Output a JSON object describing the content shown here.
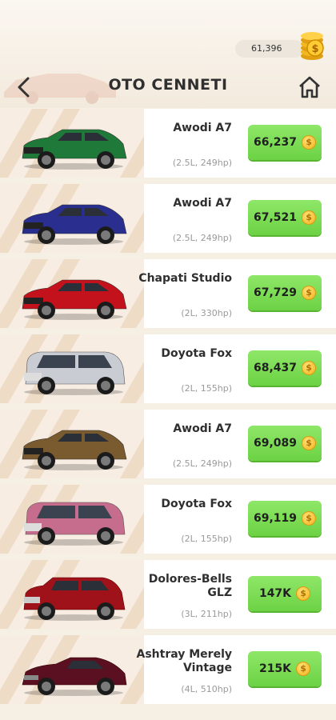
{
  "header": {
    "title": "OTO CENNETI",
    "coins": "61,396"
  },
  "cars": [
    {
      "name": "Awodi A7",
      "spec": "(2.5L, 249hp)",
      "price": "66,237",
      "color": "#1f7a3a",
      "shape": "sedan"
    },
    {
      "name": "Awodi A7",
      "spec": "(2.5L, 249hp)",
      "price": "67,521",
      "color": "#2a2f8f",
      "shape": "sedan"
    },
    {
      "name": "Chapati Studio",
      "spec": "(2L, 330hp)",
      "price": "67,729",
      "color": "#c3121b",
      "shape": "sedan"
    },
    {
      "name": "Doyota Fox",
      "spec": "(2L, 155hp)",
      "price": "68,437",
      "color": "#c9ccd2",
      "shape": "van"
    },
    {
      "name": "Awodi A7",
      "spec": "(2.5L, 249hp)",
      "price": "69,089",
      "color": "#7a5a2f",
      "shape": "sedan"
    },
    {
      "name": "Doyota Fox",
      "spec": "(2L, 155hp)",
      "price": "69,119",
      "color": "#c66c8c",
      "shape": "van"
    },
    {
      "name": "Dolores-Bells GLZ",
      "spec": "(3L, 211hp)",
      "price": "147K",
      "color": "#a0121a",
      "shape": "suv"
    },
    {
      "name": "Ashtray Merely Vintage",
      "spec": "(4L, 510hp)",
      "price": "215K",
      "color": "#5a1020",
      "shape": "coupe"
    }
  ]
}
